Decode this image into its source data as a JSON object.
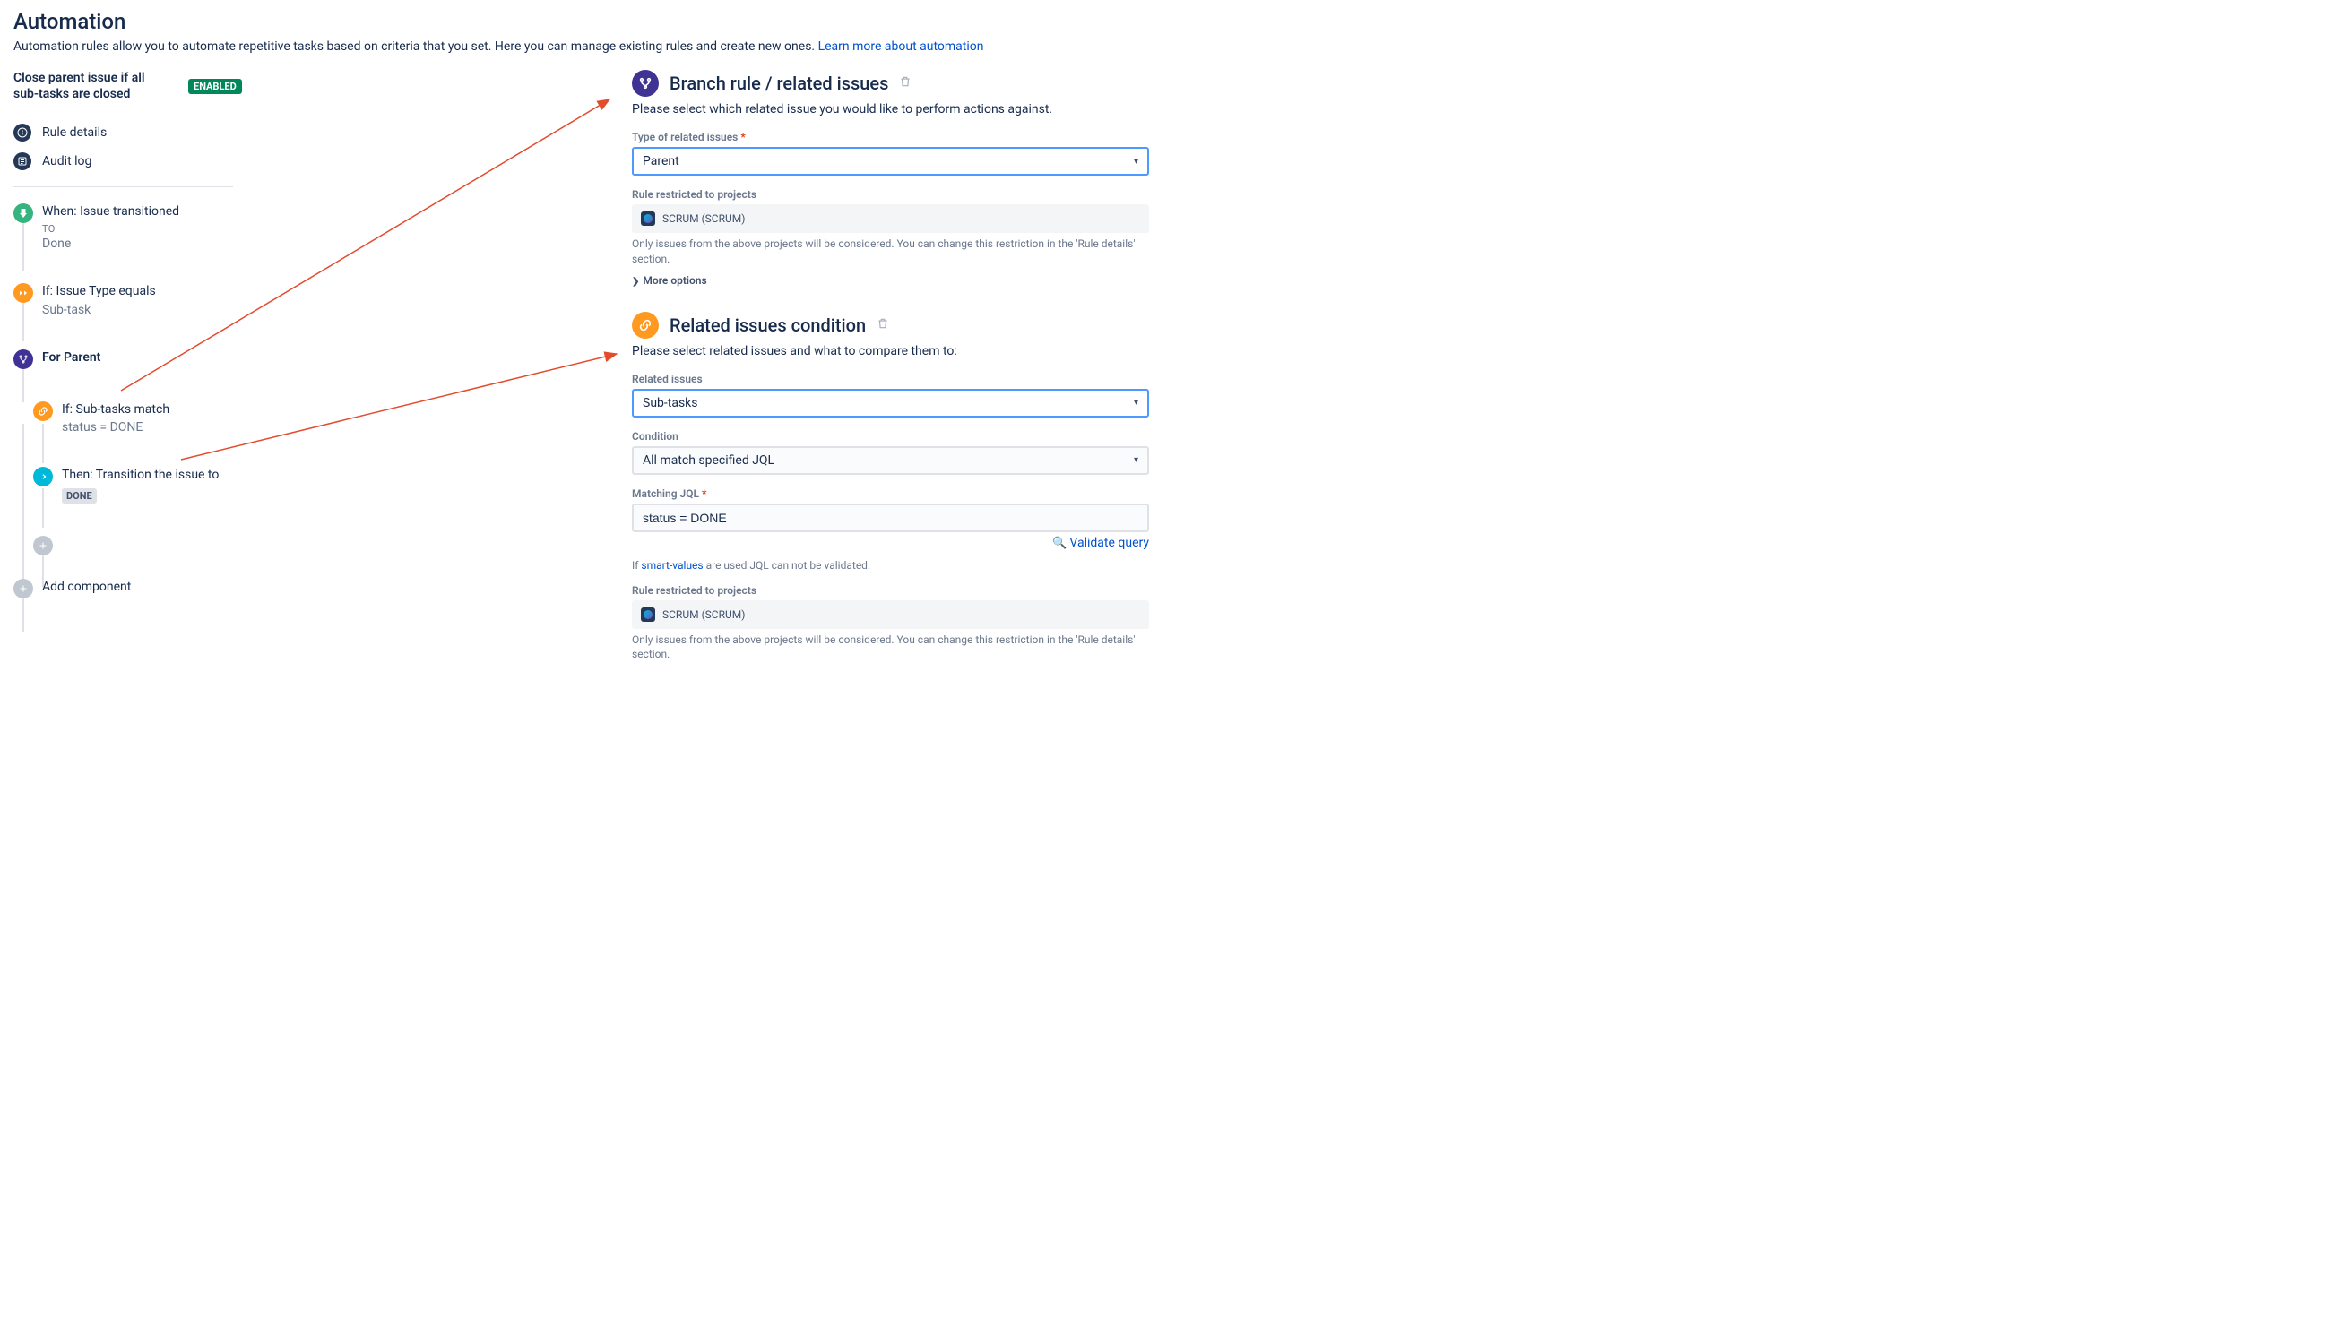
{
  "page": {
    "title": "Automation",
    "subtitle_prefix": "Automation rules allow you to automate repetitive tasks based on criteria that you set. Here you can manage existing rules and create new ones. ",
    "learn_more": "Learn more about automation"
  },
  "rule": {
    "name": "Close parent issue if all sub-tasks are closed",
    "status_badge": "ENABLED"
  },
  "nav": {
    "rule_details": "Rule details",
    "audit_log": "Audit log"
  },
  "flow": {
    "when": {
      "title": "When: Issue transitioned",
      "sub_label": "TO",
      "value": "Done"
    },
    "cond1": {
      "title": "If: Issue Type equals",
      "value": "Sub-task"
    },
    "branch": {
      "title": "For Parent"
    },
    "cond2": {
      "title": "If: Sub-tasks match",
      "value": "status = DONE"
    },
    "action": {
      "title": "Then: Transition the issue to",
      "lozenge": "DONE"
    },
    "add_component": "Add component"
  },
  "branch_panel": {
    "title": "Branch rule / related issues",
    "desc": "Please select which related issue you would like to perform actions against.",
    "type_label": "Type of related issues",
    "type_value": "Parent",
    "restrict_label": "Rule restricted to projects",
    "project": "SCRUM (SCRUM)",
    "restrict_note": "Only issues from the above projects will be considered. You can change this restriction in the 'Rule details' section.",
    "more_options": "More options"
  },
  "related_panel": {
    "title": "Related issues condition",
    "desc": "Please select related issues and what to compare them to:",
    "related_label": "Related issues",
    "related_value": "Sub-tasks",
    "condition_label": "Condition",
    "condition_value": "All match specified JQL",
    "jql_label": "Matching JQL",
    "jql_value": "status = DONE",
    "validate": "Validate query",
    "smart_prefix": "If ",
    "smart_link": "smart-values",
    "smart_suffix": " are used JQL can not be validated.",
    "restrict_label": "Rule restricted to projects",
    "project": "SCRUM (SCRUM)",
    "restrict_note": "Only issues from the above projects will be considered. You can change this restriction in the 'Rule details' section."
  }
}
